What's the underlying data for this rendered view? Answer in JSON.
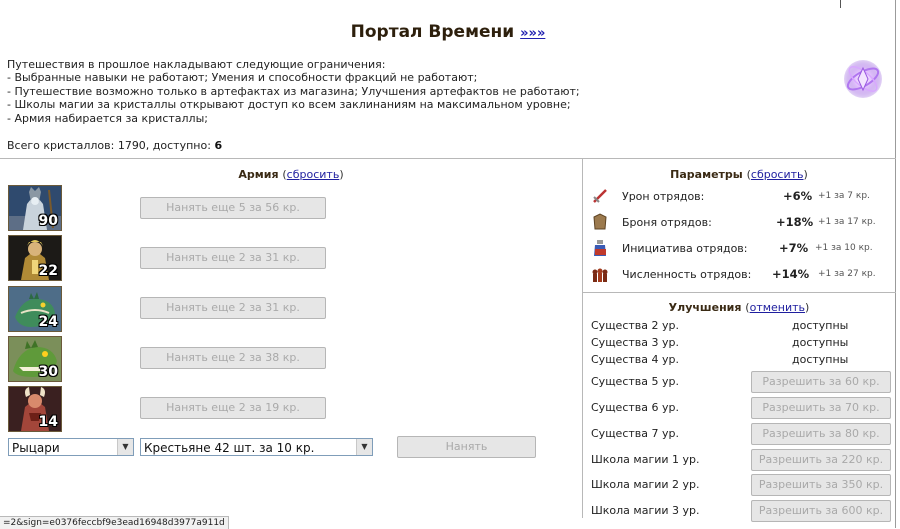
{
  "header": {
    "title": "Портал Времени",
    "link": "»»»"
  },
  "intro": {
    "lines": [
      "Путешествия в прошлое накладывают следующие ограничения:",
      "- Выбранные навыки не работают; Умения и способности фракций не работают;",
      "- Путешествие возможно только в артефактах из магазина; Улучшения артефактов не работают;",
      "- Школы магии за кристаллы открывают доступ ко всем заклинаниям на максимальном уровне;",
      "- Армия набирается за кристаллы;"
    ],
    "crystals_text": "Всего кристаллов: 1790, доступно:",
    "crystals_available": "6"
  },
  "army": {
    "title": "Армия",
    "reset_label": "сбросить",
    "units": [
      {
        "icon": "lich-icon",
        "count": "90",
        "hire_label": "Нанять еще 5 за 56 кр."
      },
      {
        "icon": "cleric-icon",
        "count": "22",
        "hire_label": "Нанять еще 2 за 31 кр."
      },
      {
        "icon": "lizard-icon",
        "count": "24",
        "hire_label": "Нанять еще 2 за 31 кр."
      },
      {
        "icon": "basilisk-icon",
        "count": "30",
        "hire_label": "Нанять еще 2 за 38 кр."
      },
      {
        "icon": "pit-fiend-icon",
        "count": "14",
        "hire_label": "Нанять еще 2 за 19 кр."
      }
    ],
    "faction_select": "Рыцари",
    "unit_select": "Крестьяне 42 шт. за 10 кр.",
    "hire_button": "Нанять"
  },
  "params": {
    "title": "Параметры",
    "reset_label": "сбросить",
    "rows": [
      {
        "icon": "sword-icon",
        "label": "Урон отрядов:",
        "value": "+6%",
        "cost": "+1 за 7 кр."
      },
      {
        "icon": "armor-icon",
        "label": "Броня отрядов:",
        "value": "+18%",
        "cost": "+1 за 17 кр."
      },
      {
        "icon": "potion-icon",
        "label": "Инициатива отрядов:",
        "value": "+7%",
        "cost": "+1 за 10 кр."
      },
      {
        "icon": "troops-icon",
        "label": "Численность отрядов:",
        "value": "+14%",
        "cost": "+1 за 27 кр."
      }
    ]
  },
  "upgrades": {
    "title": "Улучшения",
    "cancel_label": "отменить",
    "available": [
      {
        "label": "Существа 2 ур.",
        "status": "доступны"
      },
      {
        "label": "Существа 3 ур.",
        "status": "доступны"
      },
      {
        "label": "Существа 4 ур.",
        "status": "доступны"
      }
    ],
    "buyable": [
      {
        "label": "Существа 5 ур.",
        "button": "Разрешить за 60 кр."
      },
      {
        "label": "Существа 6 ур.",
        "button": "Разрешить за 70 кр."
      },
      {
        "label": "Существа 7 ур.",
        "button": "Разрешить за 80 кр."
      },
      {
        "label": "Школа магии 1 ур.",
        "button": "Разрешить за 220 кр."
      },
      {
        "label": "Школа магии 2 ур.",
        "button": "Разрешить за 350 кр."
      },
      {
        "label": "Школа магии 3 ур.",
        "button": "Разрешить за 600 кр."
      }
    ]
  },
  "status_bar": {
    "url": "=2&sign=e0376feccbf9e3ead16948d3977a911d"
  },
  "colors": {
    "link": "#1f1fb0",
    "title": "#2d1f0c",
    "disabled_bg": "#e6e6e6",
    "disabled_text": "#a9a9a9"
  }
}
